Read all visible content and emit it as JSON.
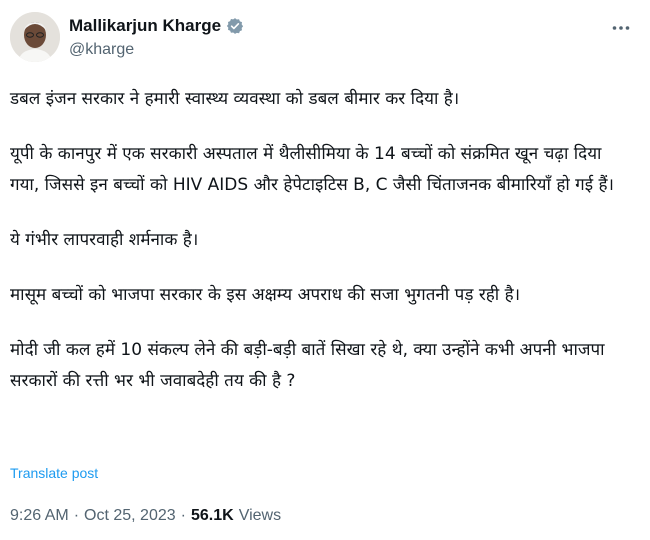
{
  "author": {
    "display_name": "Mallikarjun Kharge",
    "handle": "@kharge",
    "verified_color": "#829aab"
  },
  "post": {
    "paragraphs": [
      "डबल इंजन सरकार ने हमारी स्वास्थ्य व्यवस्था को डबल बीमार कर दिया है।",
      "यूपी के कानपुर में एक सरकारी अस्पताल में थैलीसीमिया के 14 बच्चों को संक्रमित खून चढ़ा दिया गया, जिससे इन बच्चों को HIV AIDS और हेपेटाइटिस B, C जैसी चिंताजनक बीमारियाँ हो गई हैं।",
      "ये गंभीर लापरवाही शर्मनाक है।",
      "मासूम बच्चों को भाजपा सरकार के इस अक्षम्य अपराध की सजा भुगतनी पड़ रही है।",
      "मोदी जी कल हमें 10 संकल्प लेने की बड़ी-बड़ी बातें  सिखा रहे थे, क्या उन्होंने कभी अपनी भाजपा सरकारों की रत्ती भर भी जवाबदेही तय की है ?"
    ],
    "translate_label": "Translate post"
  },
  "meta": {
    "time": "9:26 AM",
    "separator": "·",
    "date": "Oct 25, 2023",
    "views_count": "56.1K",
    "views_label": "Views"
  },
  "colors": {
    "text": "#0f1419",
    "secondary": "#536471",
    "link": "#1d9bf0"
  },
  "icons": {
    "verified": "verified-badge-icon",
    "more": "more-options-icon"
  }
}
